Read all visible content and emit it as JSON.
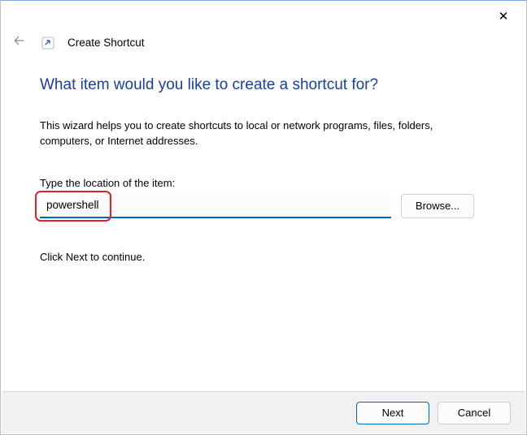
{
  "window": {
    "title": "Create Shortcut"
  },
  "main": {
    "headline": "What item would you like to create a shortcut for?",
    "description": "This wizard helps you to create shortcuts to local or network programs, files, folders, computers, or Internet addresses.",
    "location_label": "Type the location of the item:",
    "location_value": "powershell",
    "browse_label": "Browse...",
    "continue_text": "Click Next to continue."
  },
  "footer": {
    "next_label": "Next",
    "cancel_label": "Cancel"
  }
}
